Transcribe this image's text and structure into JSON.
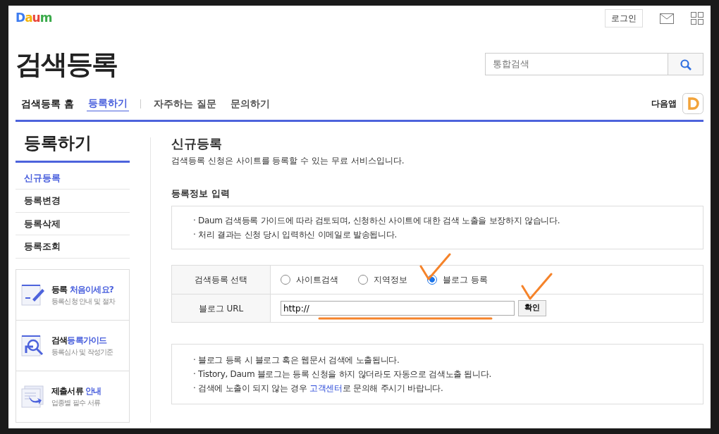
{
  "header": {
    "logo": "Daum",
    "login": "로그인",
    "title": "검색등록",
    "search": {
      "placeholder": "통합검색"
    },
    "app_label": "다음앱"
  },
  "nav": [
    {
      "label": "검색등록 홈",
      "selected": false
    },
    {
      "label": "등록하기",
      "selected": true
    },
    {
      "label": "자주하는 질문",
      "selected": false
    },
    {
      "label": "문의하기",
      "selected": false
    }
  ],
  "sidebar": {
    "title": "등록하기",
    "items": [
      {
        "label": "신규등록",
        "selected": true
      },
      {
        "label": "등록변경",
        "selected": false
      },
      {
        "label": "등록삭제",
        "selected": false
      },
      {
        "label": "등록조회",
        "selected": false
      }
    ],
    "promos": [
      {
        "kind": "pencil",
        "title": "등록 **처음이세요?**",
        "subtitle": "등록신청 안내 및 절차"
      },
      {
        "kind": "magnifier",
        "title": "검색**등록가이드**",
        "subtitle": "등록심사 및 작성기준"
      },
      {
        "kind": "documents",
        "title": "제출서류 **안내**",
        "subtitle": "업종별 필수 서류"
      }
    ]
  },
  "content": {
    "title": "신규등록",
    "description": "검색등록 신청은 사이트를 등록할 수 있는 무료 서비스입니다.",
    "section_title": "등록정보 입력",
    "notice": [
      "· Daum 검색등록 가이드에 따라 검토되며, 신청하신 사이트에 대한 검색 노출을 보장하지 않습니다.",
      "· 처리 결과는 신청 당시 입력하신 이메일로 발송됩니다."
    ],
    "form": {
      "type_label": "검색등록 선택",
      "options": [
        {
          "label": "사이트검색",
          "selected": false,
          "annotated": false
        },
        {
          "label": "지역정보",
          "selected": false,
          "annotated": false
        },
        {
          "label": "블로그 등록",
          "selected": true,
          "annotated": true
        }
      ],
      "url_label": "블로그 URL",
      "url_value": "http://",
      "url_underlined": true,
      "confirm": "확인",
      "confirm_annotated": true
    },
    "info": [
      {
        "before": "· 블로그 등록 시 블로그 혹은 웹문서 검색에 노출됩니다."
      },
      {
        "before": "· Tistory, Daum 블로그는 등록 신청을 하지 않더라도 자동으로 검색노출 됩니다."
      },
      {
        "before": "· 검색에 노출이 되지 않는 경우 ",
        "link": "고객센터",
        "after": "로 문의해 주시기 바랍니다."
      }
    ]
  }
}
